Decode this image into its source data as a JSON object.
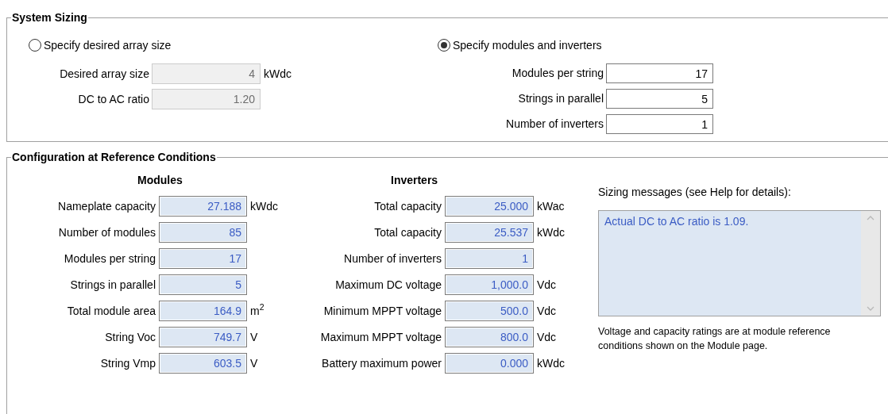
{
  "system_sizing": {
    "title": "System Sizing",
    "options": [
      {
        "label": "Specify desired array size",
        "selected": false,
        "fields": [
          {
            "label": "Desired array size",
            "value": "4",
            "unit": "kWdc",
            "disabled": true
          },
          {
            "label": "DC to AC ratio",
            "value": "1.20",
            "disabled": true
          }
        ]
      },
      {
        "label": "Specify modules and inverters",
        "selected": true,
        "fields": [
          {
            "label": "Modules per string",
            "value": "17",
            "disabled": false
          },
          {
            "label": "Strings in parallel",
            "value": "5",
            "disabled": false
          },
          {
            "label": "Number of inverters",
            "value": "1",
            "disabled": false
          }
        ]
      }
    ]
  },
  "configuration": {
    "title": "Configuration at Reference Conditions",
    "modules": {
      "heading": "Modules",
      "rows": [
        {
          "label": "Nameplate capacity",
          "value": "27.188",
          "unit": "kWdc"
        },
        {
          "label": "Number of modules",
          "value": "85"
        },
        {
          "label": "Modules per string",
          "value": "17"
        },
        {
          "label": "Strings in parallel",
          "value": "5"
        },
        {
          "label": "Total module area",
          "value": "164.9",
          "unit": "m$^{2}$"
        },
        {
          "label": "String Voc",
          "value": "749.7",
          "unit": "V"
        },
        {
          "label": "String Vmp",
          "value": "603.5",
          "unit": "V"
        }
      ]
    },
    "inverters": {
      "heading": "Inverters",
      "rows": [
        {
          "label": "Total capacity",
          "value": "25.000",
          "unit": "kWac"
        },
        {
          "label": "Total capacity",
          "value": "25.537",
          "unit": "kWdc"
        },
        {
          "label": "Number of inverters",
          "value": "1"
        },
        {
          "label": "Maximum DC voltage",
          "value": "1,000.0",
          "unit": "Vdc"
        },
        {
          "label": "Minimum MPPT voltage",
          "value": "500.0",
          "unit": "Vdc"
        },
        {
          "label": "Maximum MPPT voltage",
          "value": "800.0",
          "unit": "Vdc"
        },
        {
          "label": "Battery maximum power",
          "value": "0.000",
          "unit": "kWdc"
        }
      ]
    },
    "messages": {
      "label": "Sizing messages (see Help for details):",
      "text": "Actual DC to AC ratio is 1.09."
    },
    "note": "Voltage and capacity ratings are at module reference conditions shown on the Module page."
  }
}
